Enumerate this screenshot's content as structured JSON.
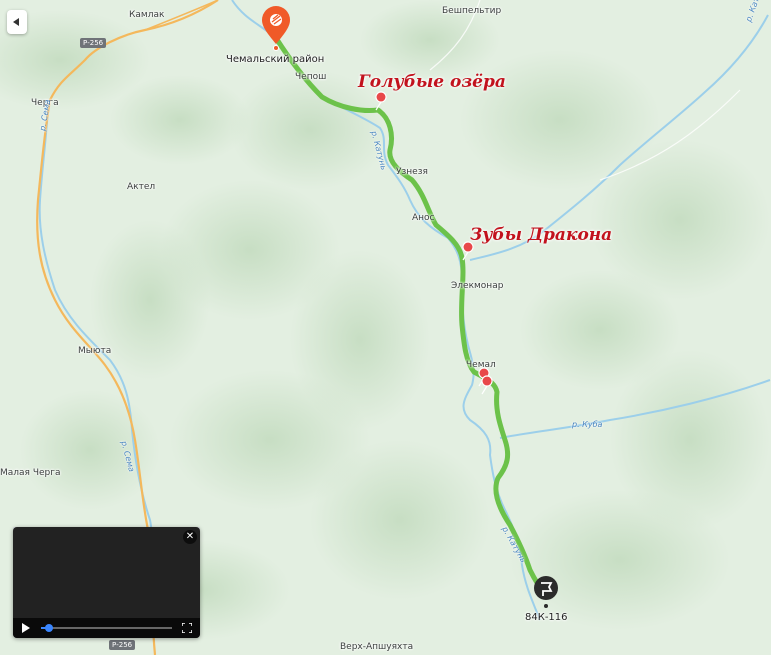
{
  "map": {
    "start_label": "Чемальский район",
    "end_label": "84К-116",
    "places": {
      "kamlak": "Камлак",
      "beshpeltir": "Бешпельтир",
      "chepos": "Чепош",
      "cherga": "Черга",
      "aktel": "Актел",
      "uznezya": "Узнезя",
      "anos": "Анос",
      "elekmonar": "Элекмонар",
      "myuta": "Мыюта",
      "chemal": "Чемал",
      "malaya_cherga": "Малая Черга",
      "verkh_apshuyakhta": "Верх-Апшуяхта"
    },
    "rivers": {
      "sema_top": "р. Сема",
      "sema_bottom": "р. Сема",
      "kuba": "р. Куба",
      "katun": "р. Катунь",
      "katun_top": "р. Катунь",
      "katun_right": "р. Катунь"
    },
    "road_badges": {
      "top": "Р-256",
      "bottom": "Р-256"
    },
    "annotations": {
      "blue_lakes": "Голубые озёра",
      "dragon_teeth": "Зубы Дракона"
    },
    "colors": {
      "route": "#6cc24a",
      "annotation": "#c2121d",
      "start_marker": "#f05a28",
      "end_marker": "#2b2b2b",
      "poi": "#e8484a",
      "river": "#8cc6ea",
      "road": "#f4b85c"
    }
  },
  "panorama": {
    "progress": 0.06
  },
  "icons": {
    "collapse": "collapse-arrow-icon",
    "close": "close-icon",
    "play": "play-icon",
    "fullscreen": "fullscreen-icon",
    "start": "flag-marker-icon",
    "end": "finish-marker-icon",
    "poi": "attraction-icon"
  }
}
